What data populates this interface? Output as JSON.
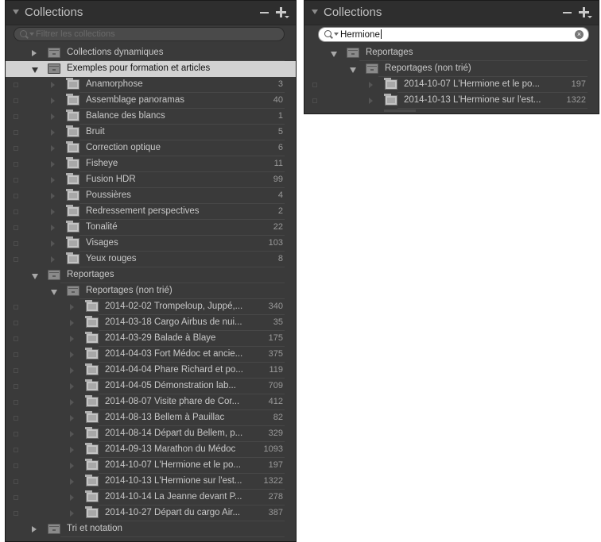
{
  "left_panel": {
    "title": "Collections",
    "search_placeholder": "Filtrer les collections",
    "rows": [
      {
        "label": "Collections dynamiques",
        "type": "set",
        "depth": 0,
        "arrow": "right",
        "check": false,
        "count": ""
      },
      {
        "label": "Exemples pour formation et articles",
        "type": "set",
        "depth": 0,
        "arrow": "down",
        "check": false,
        "count": "",
        "selected": true
      },
      {
        "label": "Anamorphose",
        "type": "col",
        "depth": 1,
        "arrow": "faint",
        "check": true,
        "count": "3"
      },
      {
        "label": "Assemblage panoramas",
        "type": "col",
        "depth": 1,
        "arrow": "faint",
        "check": true,
        "count": "40"
      },
      {
        "label": "Balance des blancs",
        "type": "col",
        "depth": 1,
        "arrow": "faint",
        "check": true,
        "count": "1"
      },
      {
        "label": "Bruit",
        "type": "col",
        "depth": 1,
        "arrow": "faint",
        "check": true,
        "count": "5"
      },
      {
        "label": "Correction optique",
        "type": "col",
        "depth": 1,
        "arrow": "faint",
        "check": true,
        "count": "6"
      },
      {
        "label": "Fisheye",
        "type": "col",
        "depth": 1,
        "arrow": "faint",
        "check": true,
        "count": "11"
      },
      {
        "label": "Fusion HDR",
        "type": "col",
        "depth": 1,
        "arrow": "faint",
        "check": true,
        "count": "99"
      },
      {
        "label": "Poussières",
        "type": "col",
        "depth": 1,
        "arrow": "faint",
        "check": true,
        "count": "4"
      },
      {
        "label": "Redressement perspectives",
        "type": "col",
        "depth": 1,
        "arrow": "faint",
        "check": true,
        "count": "2"
      },
      {
        "label": "Tonalité",
        "type": "col",
        "depth": 1,
        "arrow": "faint",
        "check": true,
        "count": "22"
      },
      {
        "label": "Visages",
        "type": "col",
        "depth": 1,
        "arrow": "faint",
        "check": true,
        "count": "103"
      },
      {
        "label": "Yeux rouges",
        "type": "col",
        "depth": 1,
        "arrow": "faint",
        "check": true,
        "count": "8"
      },
      {
        "label": "Reportages",
        "type": "set",
        "depth": 0,
        "arrow": "down",
        "check": false,
        "count": ""
      },
      {
        "label": "Reportages (non trié)",
        "type": "set",
        "depth": 1,
        "arrow": "down",
        "check": false,
        "count": ""
      },
      {
        "label": "2014-02-02 Trompeloup, Juppé,...",
        "type": "col",
        "depth": 2,
        "arrow": "faint",
        "check": true,
        "count": "340"
      },
      {
        "label": "2014-03-18 Cargo Airbus de nui...",
        "type": "col",
        "depth": 2,
        "arrow": "faint",
        "check": true,
        "count": "35"
      },
      {
        "label": "2014-03-29 Balade à Blaye",
        "type": "col",
        "depth": 2,
        "arrow": "faint",
        "check": true,
        "count": "175"
      },
      {
        "label": "2014-04-03 Fort Médoc et ancie...",
        "type": "col",
        "depth": 2,
        "arrow": "faint",
        "check": true,
        "count": "375"
      },
      {
        "label": "2014-04-04 Phare Richard et po...",
        "type": "col",
        "depth": 2,
        "arrow": "faint",
        "check": true,
        "count": "119"
      },
      {
        "label": "2014-04-05 Démonstration lab...",
        "type": "col",
        "depth": 2,
        "arrow": "faint",
        "check": true,
        "count": "709"
      },
      {
        "label": "2014-08-07 Visite phare de Cor...",
        "type": "col",
        "depth": 2,
        "arrow": "faint",
        "check": true,
        "count": "412"
      },
      {
        "label": "2014-08-13 Bellem à Pauillac",
        "type": "col",
        "depth": 2,
        "arrow": "faint",
        "check": true,
        "count": "82"
      },
      {
        "label": "2014-08-14 Départ du Bellem, p...",
        "type": "col",
        "depth": 2,
        "arrow": "faint",
        "check": true,
        "count": "329"
      },
      {
        "label": "2014-09-13 Marathon du Médoc",
        "type": "col",
        "depth": 2,
        "arrow": "faint",
        "check": true,
        "count": "1093"
      },
      {
        "label": "2014-10-07 L'Hermione et le po...",
        "type": "col",
        "depth": 2,
        "arrow": "faint",
        "check": true,
        "count": "197"
      },
      {
        "label": "2014-10-13 L'Hermione sur l'est...",
        "type": "col",
        "depth": 2,
        "arrow": "faint",
        "check": true,
        "count": "1322"
      },
      {
        "label": "2014-10-14 La Jeanne devant P...",
        "type": "col",
        "depth": 2,
        "arrow": "faint",
        "check": true,
        "count": "278"
      },
      {
        "label": "2014-10-27 Départ du cargo Air...",
        "type": "col",
        "depth": 2,
        "arrow": "faint",
        "check": true,
        "count": "387"
      },
      {
        "label": "Tri et notation",
        "type": "set",
        "depth": 0,
        "arrow": "right",
        "check": false,
        "count": ""
      }
    ]
  },
  "right_panel": {
    "title": "Collections",
    "search_value": "Hermione",
    "rows": [
      {
        "label": "Reportages",
        "type": "set",
        "depth": 0,
        "arrow": "down",
        "check": false,
        "count": ""
      },
      {
        "label": "Reportages (non trié)",
        "type": "set",
        "depth": 1,
        "arrow": "down",
        "check": false,
        "count": ""
      },
      {
        "label": "2014-10-07 L'Hermione et le po...",
        "type": "col",
        "depth": 2,
        "arrow": "faint",
        "check": true,
        "count": "197"
      },
      {
        "label": "2014-10-13 L'Hermione sur l'est...",
        "type": "col",
        "depth": 2,
        "arrow": "faint",
        "check": true,
        "count": "1322"
      }
    ]
  }
}
